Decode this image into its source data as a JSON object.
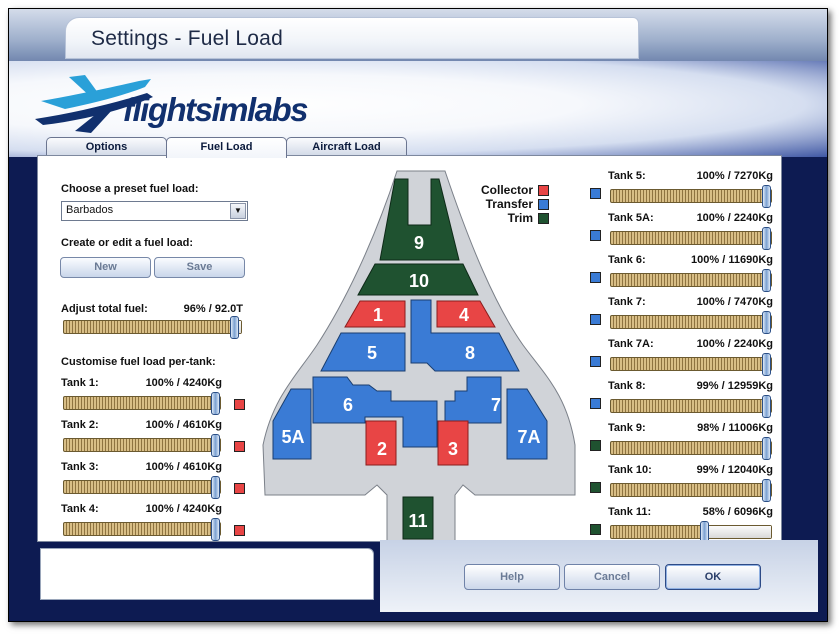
{
  "window": {
    "title": "Settings - Fuel Load"
  },
  "brand": {
    "logo_text": "flightsimlabs"
  },
  "tabs": [
    {
      "label": "Options",
      "active": false
    },
    {
      "label": "Fuel Load",
      "active": true
    },
    {
      "label": "Aircraft Load",
      "active": false
    }
  ],
  "left": {
    "preset_label": "Choose a preset fuel load:",
    "preset_value": "Barbados",
    "create_label": "Create or edit a fuel load:",
    "new_button": "New",
    "save_button": "Save",
    "adjust_label": "Adjust total fuel:",
    "adjust_value": "96% / 92.0T",
    "adjust_fraction": 0.96,
    "customise_label": "Customise fuel load per-tank:"
  },
  "tanks": [
    {
      "label": "Tank 1:",
      "value": "100% / 4240Kg",
      "fraction": 1.0,
      "type": "Collector"
    },
    {
      "label": "Tank 2:",
      "value": "100% / 4610Kg",
      "fraction": 1.0,
      "type": "Collector"
    },
    {
      "label": "Tank 3:",
      "value": "100% / 4610Kg",
      "fraction": 1.0,
      "type": "Collector"
    },
    {
      "label": "Tank 4:",
      "value": "100% / 4240Kg",
      "fraction": 1.0,
      "type": "Collector"
    },
    {
      "label": "Tank 5:",
      "value": "100% / 7270Kg",
      "fraction": 1.0,
      "type": "Transfer"
    },
    {
      "label": "Tank 5A:",
      "value": "100% / 2240Kg",
      "fraction": 1.0,
      "type": "Transfer"
    },
    {
      "label": "Tank 6:",
      "value": "100% / 11690Kg",
      "fraction": 1.0,
      "type": "Transfer"
    },
    {
      "label": "Tank 7:",
      "value": "100% / 7470Kg",
      "fraction": 1.0,
      "type": "Transfer"
    },
    {
      "label": "Tank 7A:",
      "value": "100% / 2240Kg",
      "fraction": 1.0,
      "type": "Transfer"
    },
    {
      "label": "Tank 8:",
      "value": "99% / 12959Kg",
      "fraction": 0.99,
      "type": "Transfer"
    },
    {
      "label": "Tank 9:",
      "value": "98% / 11006Kg",
      "fraction": 0.98,
      "type": "Trim"
    },
    {
      "label": "Tank 10:",
      "value": "99% / 12040Kg",
      "fraction": 0.99,
      "type": "Trim"
    },
    {
      "label": "Tank 11:",
      "value": "58% / 6096Kg",
      "fraction": 0.58,
      "type": "Trim"
    }
  ],
  "legend": [
    {
      "label": "Collector",
      "color": "#e84545"
    },
    {
      "label": "Transfer",
      "color": "#3a7bd5"
    },
    {
      "label": "Trim",
      "color": "#1f5230"
    }
  ],
  "diagram_labels": {
    "t9": "9",
    "t10": "10",
    "t1": "1",
    "t4": "4",
    "t5": "5",
    "t8": "8",
    "t6": "6",
    "t7": "7",
    "t5a": "5A",
    "t7a": "7A",
    "t2": "2",
    "t3": "3",
    "t11": "11"
  },
  "footer": {
    "help": "Help",
    "cancel": "Cancel",
    "ok": "OK"
  }
}
